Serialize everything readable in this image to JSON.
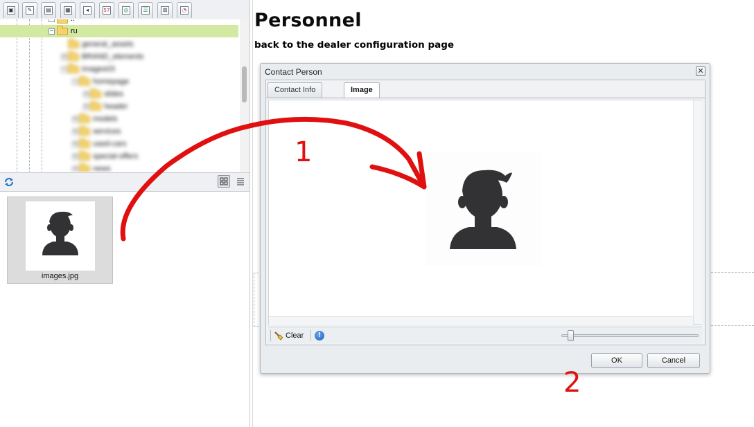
{
  "toolbar": {
    "tabs": [
      {
        "name": "images-tab",
        "glyph": "▣"
      },
      {
        "name": "brush-tab",
        "glyph": "✎"
      },
      {
        "name": "document-tab",
        "glyph": "▤"
      },
      {
        "name": "media-tab",
        "glyph": "▦"
      },
      {
        "name": "audio-tab",
        "glyph": "◂"
      },
      {
        "name": "flash-tab",
        "glyph": "57"
      },
      {
        "name": "globe-tab",
        "glyph": "◎"
      },
      {
        "name": "table-tab",
        "glyph": "☰"
      },
      {
        "name": "sitemap-tab",
        "glyph": "⊞"
      },
      {
        "name": "settings-tab",
        "glyph": "◔"
      }
    ]
  },
  "tree": {
    "selected_label": "ru",
    "partial_label": "..",
    "blurred_labels": [
      "general_assets",
      "BRAND_elements",
      "images03",
      "homepage",
      "slides",
      "header",
      "models",
      "services",
      "used-cars",
      "special-offers",
      "news"
    ]
  },
  "files": {
    "filename": "images.jpg"
  },
  "page": {
    "title": "Personnel",
    "back_link": "back to the dealer configuration page"
  },
  "dialog": {
    "title": "Contact Person",
    "close_glyph": "✕",
    "tabs": [
      "Contact Info",
      "Image"
    ],
    "active_tab": "Image",
    "clear_label": "Clear",
    "info_glyph": "!",
    "zoom_level": 0.05,
    "ok_label": "OK",
    "cancel_label": "Cancel"
  },
  "annotations": {
    "step1": "1",
    "step2": "2",
    "arrow_color": "#e01010"
  }
}
